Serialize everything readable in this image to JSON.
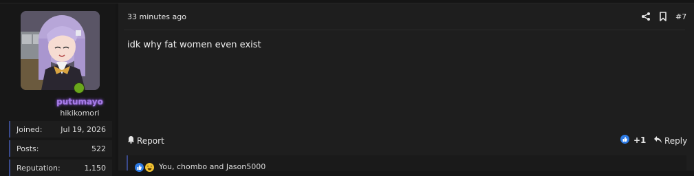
{
  "user": {
    "username": "putumayo",
    "user_title": "hikikomori",
    "online": true,
    "stats": [
      {
        "label": "Joined:",
        "value": "Jul 19, 2026"
      },
      {
        "label": "Posts:",
        "value": "522"
      },
      {
        "label": "Reputation:",
        "value": "1,150"
      }
    ]
  },
  "post": {
    "timestamp": "33 minutes ago",
    "post_number": "#7",
    "message": "idk why fat women even exist",
    "actions": {
      "report_label": "Report",
      "like_count": "+1",
      "reply_label": "Reply"
    },
    "reactions": {
      "summary": "You, chombo and Jason5000"
    },
    "icons": {
      "share": "share-icon",
      "bookmark": "bookmark-icon",
      "report": "bell-icon",
      "reply": "reply-arrow-icon",
      "like": "thumbs-up-icon",
      "laugh": "laughing-face-icon"
    }
  },
  "colors": {
    "background": "#151515",
    "panel": "#1e1e1e",
    "username": "#a77de6",
    "accent_border": "#3a4a8c",
    "online": "#6aa71c",
    "like": "#2d7be5",
    "laugh": "#f1c232"
  }
}
